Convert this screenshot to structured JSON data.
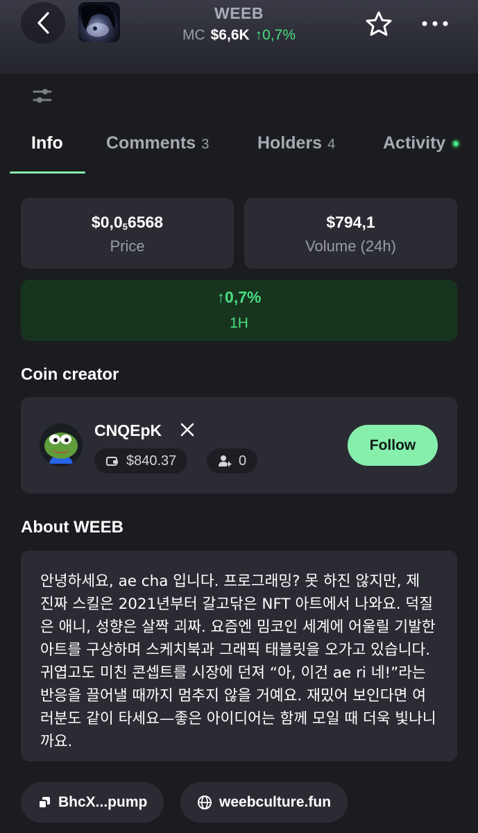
{
  "header": {
    "coin_name": "WEEB",
    "mc_label": "MC",
    "mc_value": "$6,6K",
    "mc_change": "↑0,7%"
  },
  "tabs": [
    {
      "label": "Info",
      "count": ""
    },
    {
      "label": "Comments",
      "count": "3"
    },
    {
      "label": "Holders",
      "count": "4"
    },
    {
      "label": "Activity",
      "count": ""
    }
  ],
  "stats": {
    "price_prefix": "$0,0",
    "price_zeros": "5",
    "price_suffix": "6568",
    "price_label": "Price",
    "volume_value": "$794,1",
    "volume_label": "Volume (24h)",
    "change_value": "↑0,7%",
    "change_period": "1H"
  },
  "creator": {
    "section_title": "Coin creator",
    "name": "CNQEpK",
    "balance": "$840.37",
    "followers": "0",
    "follow_label": "Follow"
  },
  "about": {
    "section_title": "About WEEB",
    "text": "안녕하세요, ae cha 입니다. 프로그래밍? 못 하진 않지만, 제 진짜 스킬은 2021년부터 갈고닦은 NFT 아트에서 나와요. 덕질은 애니, 성향은 살짝 괴짜. 요즘엔 밈코인 세계에 어울릴 기발한 아트를 구상하며 스케치북과 그래픽 태블릿을 오가고 있습니다. 귀엽고도 미친 콘셉트를 시장에 던져 “아, 이건 ae ri 네!”라는 반응을 끌어낼 때까지 멈추지 않을 거예요. 재밌어 보인다면 여러분도 같이 타세요—좋은 아이디어는 함께 모일 때 더욱 빛나니까요."
  },
  "links": {
    "contract": "BhcX...pump",
    "website": "weebculture.fun"
  },
  "colors": {
    "accent_green": "#4ade80",
    "follow_bg": "#86efac",
    "card_bg": "#2b2c33",
    "page_bg": "#1b1c20"
  },
  "icons": [
    "back-icon",
    "star-icon",
    "more-icon",
    "filter-icon",
    "x-logo-icon",
    "wallet-icon",
    "add-user-icon",
    "copy-icon",
    "globe-icon"
  ]
}
